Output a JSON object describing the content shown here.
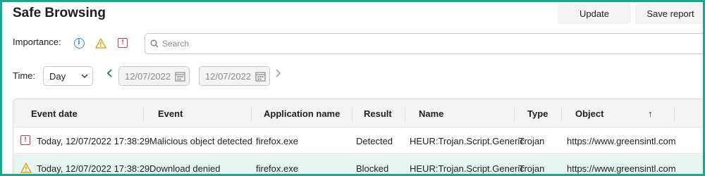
{
  "title": "Safe Browsing",
  "buttons": {
    "update": "Update",
    "save_report": "Save report"
  },
  "filters": {
    "importance_label": "Importance:",
    "importance_icons": [
      "info-icon",
      "warning-icon",
      "critical-icon"
    ],
    "search_placeholder": "Search",
    "time_label": "Time:",
    "time_value": "Day",
    "date_from": "12/07/2022",
    "date_to": "12/07/2022"
  },
  "table": {
    "columns": [
      "Event date",
      "Event",
      "Application name",
      "Result",
      "Name",
      "Type",
      "Object",
      "↑"
    ],
    "rows": [
      {
        "severity": "critical",
        "event_date": "Today, 12/07/2022 17:38:29",
        "event": "Malicious object detected",
        "application": "firefox.exe",
        "result": "Detected",
        "name": "HEUR:Trojan.Script.Generic",
        "type": "Trojan",
        "object": "https://www.greensintl.com"
      },
      {
        "severity": "warning",
        "event_date": "Today, 12/07/2022 17:38:29",
        "event": "Download denied",
        "application": "firefox.exe",
        "result": "Blocked",
        "name": "HEUR:Trojan.Script.Generic",
        "type": "Trojan",
        "object": "https://www.greensintl.com"
      }
    ]
  },
  "colors": {
    "frame": "#1aa88a",
    "info": "#2a8ad8",
    "warning": "#e3a21a",
    "critical": "#d03a48",
    "selected_row": "#e6f5ef",
    "accent_green": "#1a7f62"
  }
}
